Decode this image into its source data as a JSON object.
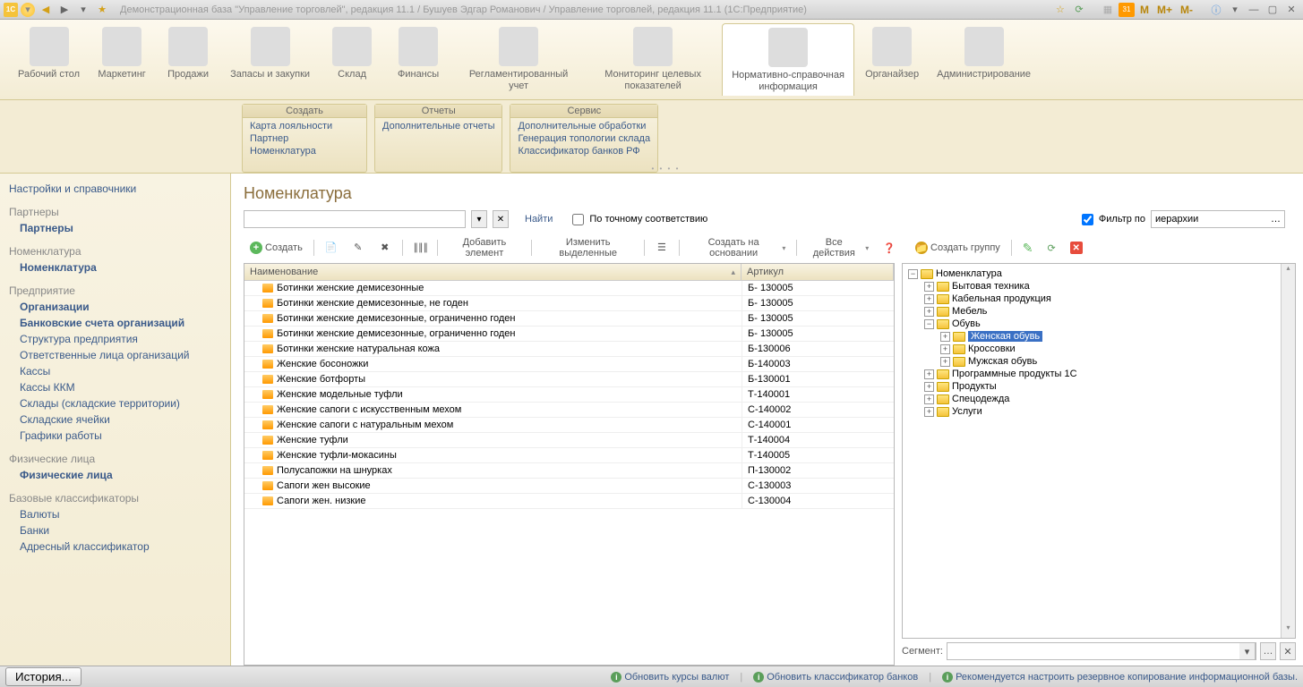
{
  "titlebar": {
    "title": "Демонстрационная база \"Управление торговлей\", редакция 11.1 / Бушуев Эдгар Романович / Управление торговлей, редакция 11.1 (1С:Предприятие)"
  },
  "sections": [
    {
      "label": "Рабочий стол"
    },
    {
      "label": "Маркетинг"
    },
    {
      "label": "Продажи"
    },
    {
      "label": "Запасы и закупки"
    },
    {
      "label": "Склад"
    },
    {
      "label": "Финансы"
    },
    {
      "label": "Регламентированный учет"
    },
    {
      "label": "Мониторинг целевых показателей"
    },
    {
      "label": "Нормативно-справочная информация",
      "active": true
    },
    {
      "label": "Органайзер"
    },
    {
      "label": "Администрирование"
    }
  ],
  "panels": {
    "create": {
      "title": "Создать",
      "items": [
        "Карта лояльности",
        "Партнер",
        "Номенклатура"
      ]
    },
    "reports": {
      "title": "Отчеты",
      "items": [
        "Дополнительные отчеты"
      ]
    },
    "service": {
      "title": "Сервис",
      "items": [
        "Дополнительные обработки",
        "Генерация топологии склада",
        "Классификатор банков РФ"
      ]
    }
  },
  "leftnav": {
    "top": "Настройки и справочники",
    "groups": [
      {
        "title": "Партнеры",
        "items": [
          {
            "label": "Партнеры",
            "bold": true
          }
        ]
      },
      {
        "title": "Номенклатура",
        "items": [
          {
            "label": "Номенклатура",
            "bold": true
          }
        ]
      },
      {
        "title": "Предприятие",
        "items": [
          {
            "label": "Организации",
            "bold": true
          },
          {
            "label": "Банковские счета организаций",
            "bold": true
          },
          {
            "label": "Структура предприятия"
          },
          {
            "label": "Ответственные лица организаций"
          },
          {
            "label": "Кассы"
          },
          {
            "label": "Кассы ККМ"
          },
          {
            "label": "Склады (складские территории)"
          },
          {
            "label": "Складские ячейки"
          },
          {
            "label": "Графики работы"
          }
        ]
      },
      {
        "title": "Физические лица",
        "items": [
          {
            "label": "Физические лица",
            "bold": true
          }
        ]
      },
      {
        "title": "Базовые классификаторы",
        "items": [
          {
            "label": "Валюты"
          },
          {
            "label": "Банки"
          },
          {
            "label": "Адресный классификатор"
          }
        ]
      }
    ]
  },
  "main": {
    "title": "Номенклатура",
    "search_find": "Найти",
    "exact_match": "По точному соответствию",
    "filter_label": "Фильтр по",
    "filter_value": "иерархии",
    "toolbar": {
      "create": "Создать",
      "add_element": "Добавить элемент",
      "edit_selected": "Изменить выделенные",
      "create_based": "Создать на основании",
      "all_actions": "Все действия",
      "create_group": "Создать группу"
    },
    "table": {
      "headers": {
        "name": "Наименование",
        "article": "Артикул"
      },
      "rows": [
        {
          "name": "Ботинки женские демисезонные",
          "art": "Б- 130005"
        },
        {
          "name": "Ботинки женские демисезонные, не годен",
          "art": "Б- 130005"
        },
        {
          "name": "Ботинки женские демисезонные, ограниченно годен",
          "art": "Б- 130005"
        },
        {
          "name": "Ботинки женские демисезонные, ограниченно годен",
          "art": "Б- 130005"
        },
        {
          "name": "Ботинки женские натуральная кожа",
          "art": "Б-130006"
        },
        {
          "name": "Женские босоножки",
          "art": "Б-140003"
        },
        {
          "name": "Женские ботфорты",
          "art": "Б-130001"
        },
        {
          "name": "Женские модельные туфли",
          "art": "Т-140001"
        },
        {
          "name": "Женские сапоги с искусственным мехом",
          "art": "С-140002"
        },
        {
          "name": "Женские сапоги с натуральным мехом",
          "art": "С-140001"
        },
        {
          "name": "Женские туфли",
          "art": "Т-140004"
        },
        {
          "name": "Женские туфли-мокасины",
          "art": "Т-140005"
        },
        {
          "name": "Полусапожки на шнурках",
          "art": "П-130002"
        },
        {
          "name": "Сапоги жен высокие",
          "art": "С-130003"
        },
        {
          "name": "Сапоги жен. низкие",
          "art": "С-130004"
        }
      ]
    },
    "tree": [
      {
        "label": "Номенклатура",
        "indent": 0,
        "exp": "-"
      },
      {
        "label": "Бытовая техника",
        "indent": 1,
        "exp": "+"
      },
      {
        "label": "Кабельная продукция",
        "indent": 1,
        "exp": "+"
      },
      {
        "label": "Мебель",
        "indent": 1,
        "exp": "+"
      },
      {
        "label": "Обувь",
        "indent": 1,
        "exp": "-"
      },
      {
        "label": "Женская обувь",
        "indent": 2,
        "exp": "+",
        "selected": true
      },
      {
        "label": "Кроссовки",
        "indent": 2,
        "exp": "+"
      },
      {
        "label": "Мужская обувь",
        "indent": 2,
        "exp": "+"
      },
      {
        "label": "Программные продукты 1С",
        "indent": 1,
        "exp": "+"
      },
      {
        "label": "Продукты",
        "indent": 1,
        "exp": "+"
      },
      {
        "label": "Спецодежда",
        "indent": 1,
        "exp": "+"
      },
      {
        "label": "Услуги",
        "indent": 1,
        "exp": "+"
      }
    ],
    "segment_label": "Сегмент:"
  },
  "statusbar": {
    "history": "История...",
    "links": [
      "Обновить курсы валют",
      "Обновить классификатор банков",
      "Рекомендуется настроить резервное копирование информационной базы."
    ]
  }
}
